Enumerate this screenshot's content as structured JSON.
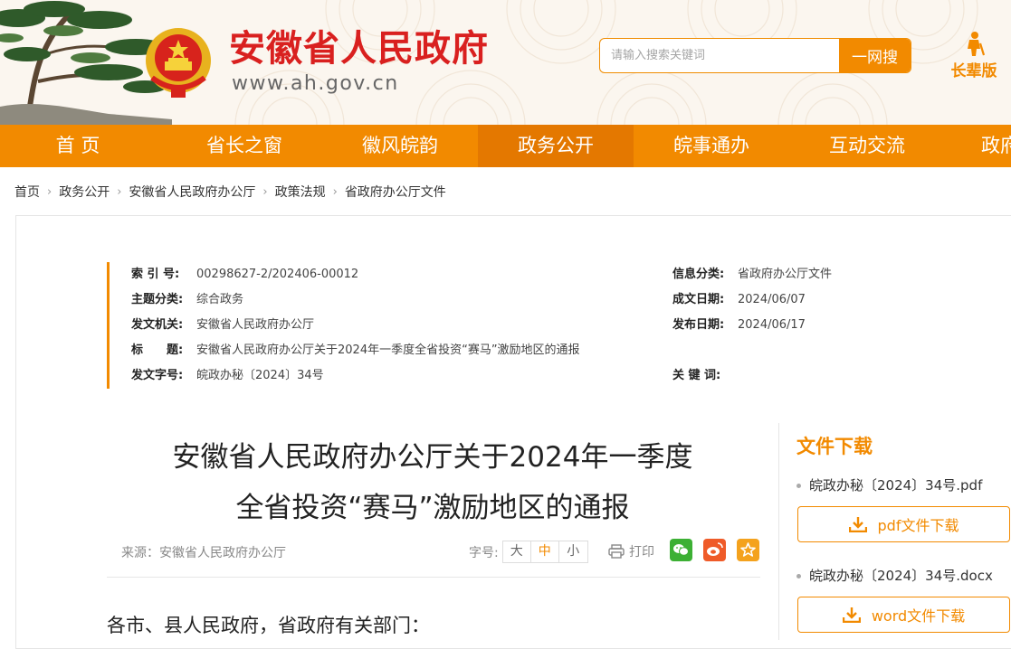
{
  "header": {
    "site_title": "安徽省人民政府",
    "site_domain": "www.ah.gov.cn",
    "search_placeholder": "请输入搜索关键词",
    "search_button": "一网搜",
    "elder_version": "长辈版"
  },
  "nav": {
    "items": [
      "首 页",
      "省长之窗",
      "徽风皖韵",
      "政务公开",
      "皖事通办",
      "互动交流",
      "政府"
    ],
    "active_index": 3
  },
  "breadcrumb": [
    "首页",
    "政务公开",
    "安徽省人民政府办公厅",
    "政策法规",
    "省政府办公厅文件"
  ],
  "meta": {
    "index_no_label": "索 引 号:",
    "index_no": "00298627-2/202406-00012",
    "topic_label": "主题分类:",
    "topic": "综合政务",
    "issuer_label": "发文机关:",
    "issuer": "安徽省人民政府办公厅",
    "title_label": "标　　题:",
    "title": "安徽省人民政府办公厅关于2024年一季度全省投资“赛马”激励地区的通报",
    "doc_no_label": "发文字号:",
    "doc_no": "皖政办秘〔2024〕34号",
    "category_label": "信息分类:",
    "category": "省政府办公厅文件",
    "written_label": "成文日期:",
    "written_date": "2024/06/07",
    "published_label": "发布日期:",
    "published_date": "2024/06/17",
    "keywords_label": "关 键 词:",
    "keywords": ""
  },
  "document": {
    "title_line1": "安徽省人民政府办公厅关于2024年一季度",
    "title_line2": "全省投资“赛马”激励地区的通报",
    "source": "来源：安徽省人民政府办公厅",
    "font_size_label": "字号:",
    "font_sizes": [
      "大",
      "中",
      "小"
    ],
    "print_label": "打印",
    "greeting": "各市、县人民政府，省政府有关部门："
  },
  "downloads": {
    "title": "文件下载",
    "files": [
      {
        "name": "皖政办秘〔2024〕34号.pdf",
        "button": "pdf文件下载"
      },
      {
        "name": "皖政办秘〔2024〕34号.docx",
        "button": "word文件下载"
      }
    ]
  },
  "colors": {
    "brand_orange": "#f28a00",
    "title_red": "#d9201f",
    "wechat_green": "#3cb034",
    "weibo_orange": "#ef5b29",
    "favorite_orange": "#f4a21d"
  }
}
